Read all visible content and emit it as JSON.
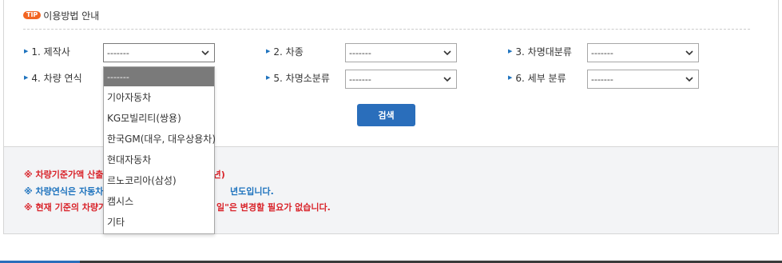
{
  "tip": {
    "badge": "TIP",
    "title": "이용방법 안내"
  },
  "fields": {
    "maker": {
      "label": "1. 제작사",
      "value": "-------"
    },
    "car_type": {
      "label": "2. 차종",
      "value": "-------"
    },
    "model_major": {
      "label": "3. 차명대분류",
      "value": "-------"
    },
    "year": {
      "label": "4. 차량 연식",
      "value": "-------"
    },
    "model_minor": {
      "label": "5. 차명소분류",
      "value": "-------"
    },
    "detail": {
      "label": "6. 세부 분류",
      "value": "-------"
    }
  },
  "search_label": "검색",
  "notices": [
    {
      "text": "※ 차량기준가액 산출",
      "tail": "3년)",
      "color": "red"
    },
    {
      "text": "※ 차량연식은 자동차",
      "tail": "년도입니다.",
      "color": "blue"
    },
    {
      "text": "※ 현재 기준의 차량가",
      "tail": "일\"은 변경할 필요가 없습니다.",
      "color": "red"
    }
  ],
  "dropdown": {
    "selected": "-------",
    "options": [
      "기아자동차",
      "KG모빌리티(쌍용)",
      "한국GM(대우, 대우상용차)",
      "현대자동차",
      "르노코리아(삼성)",
      "캠시스",
      "기타"
    ]
  }
}
